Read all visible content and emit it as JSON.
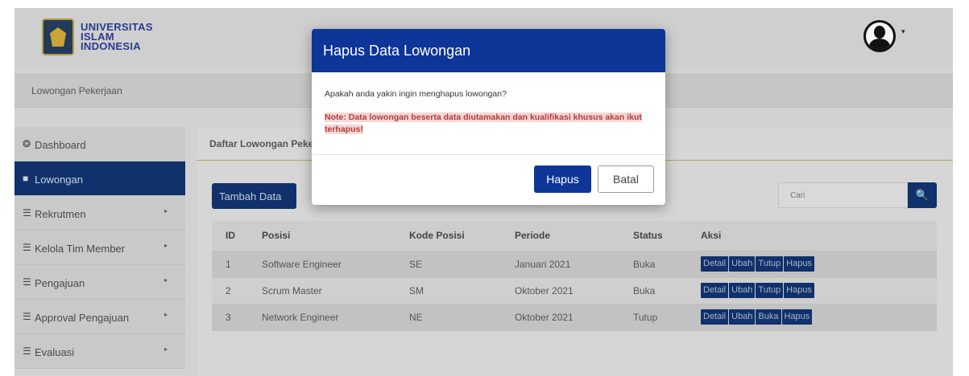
{
  "header": {
    "logo_lines": [
      "UNIVERSITAS",
      "ISLAM",
      "INDONESIA"
    ],
    "avatar_icon": "user-circle-icon",
    "avatar_caret": "▾"
  },
  "breadcrumb": "Lowongan Pekerjaan",
  "sidebar": {
    "items": [
      {
        "label": "Dashboard",
        "icon": "dashboard-icon",
        "glyph": "❂",
        "active": false
      },
      {
        "label": "Lowongan",
        "icon": "briefcase-icon",
        "glyph": "■",
        "active": true
      },
      {
        "label": "Rekrutmen",
        "icon": "list-icon",
        "glyph": "☰",
        "arrow": "▸"
      },
      {
        "label": "Kelola Tim Member",
        "icon": "list-icon",
        "glyph": "☰",
        "arrow": "▸"
      },
      {
        "label": "Pengajuan",
        "icon": "list-icon",
        "glyph": "☰",
        "arrow": "▸"
      },
      {
        "label": "Approval Pengajuan",
        "icon": "list-icon",
        "glyph": "☰",
        "arrow": "▸"
      },
      {
        "label": "Evaluasi",
        "icon": "list-icon",
        "glyph": "☰",
        "arrow": "▸"
      }
    ]
  },
  "main": {
    "title": "Daftar Lowongan Pekerjaan",
    "add_button": "Tambah Data",
    "search_placeholder": "Cari",
    "search_icon": "🔍",
    "table": {
      "headers": [
        "ID",
        "Posisi",
        "Kode Posisi",
        "Periode",
        "Status",
        "Aksi"
      ],
      "rows": [
        {
          "id": "1",
          "posisi": "Software Engineer",
          "kode": "SE",
          "periode": "Januari 2021",
          "status": "Buka",
          "actions": [
            "Detail",
            "Ubah",
            "Tutup",
            "Hapus"
          ]
        },
        {
          "id": "2",
          "posisi": "Scrum Master",
          "kode": "SM",
          "periode": "Oktober 2021",
          "status": "Buka",
          "actions": [
            "Detail",
            "Ubah",
            "Tutup",
            "Hapus"
          ]
        },
        {
          "id": "3",
          "posisi": "Network Engineer",
          "kode": "NE",
          "periode": "Oktober 2021",
          "status": "Tutup",
          "actions": [
            "Detail",
            "Ubah",
            "Buka",
            "Hapus"
          ]
        }
      ]
    }
  },
  "modal": {
    "title": "Hapus Data Lowongan",
    "message": "Apakah anda yakin ingin menghapus lowongan?",
    "note": "Note: Data lowongan beserta data diutamakan dan kualifikasi khusus akan ikut terhapus!",
    "confirm_button": "Hapus",
    "cancel_button": "Batal"
  },
  "colors": {
    "primary": "#10316b",
    "modal_header": "#0e3598",
    "note_text": "#b53a3a",
    "overlay": "#d2d2d2"
  }
}
